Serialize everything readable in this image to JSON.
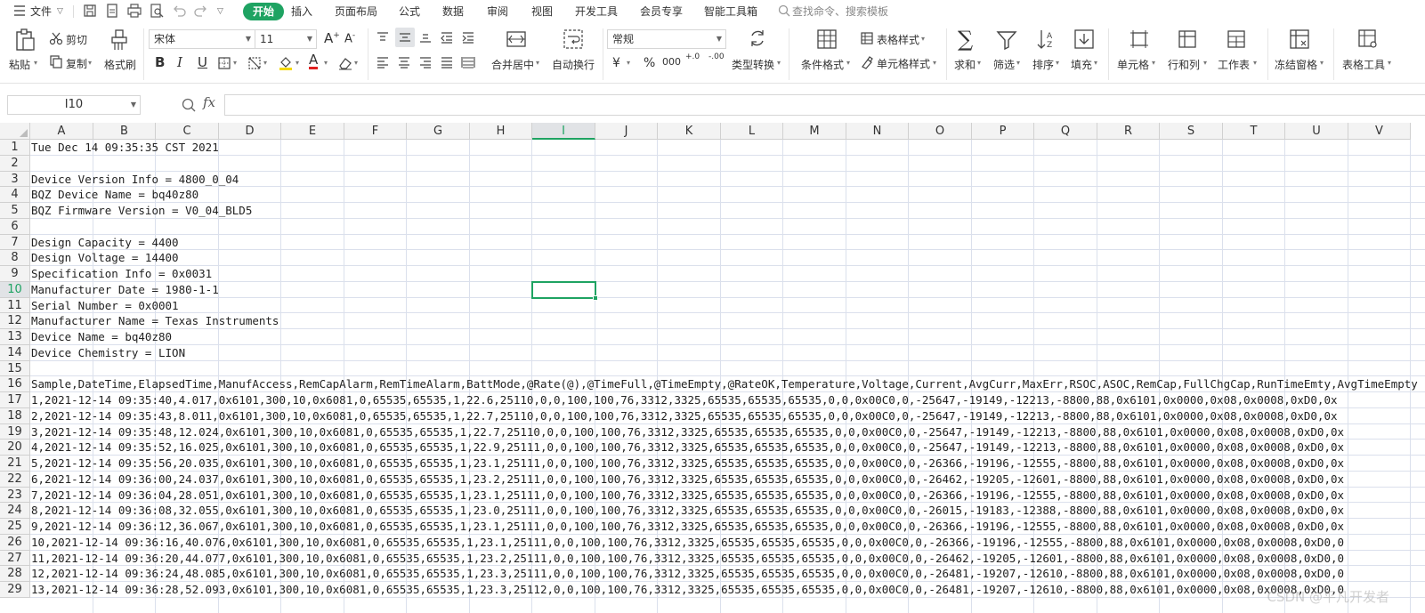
{
  "menu": {
    "file": "文件",
    "tabs": [
      "开始",
      "插入",
      "页面布局",
      "公式",
      "数据",
      "审阅",
      "视图",
      "开发工具",
      "会员专享",
      "智能工具箱"
    ],
    "search_placeholder": "查找命令、搜索模板"
  },
  "ribbon": {
    "paste": "粘贴",
    "cut": "剪切",
    "copy": "复制",
    "format_painter": "格式刷",
    "font_name": "宋体",
    "font_size": "11",
    "merge_center": "合并居中",
    "wrap_text": "自动换行",
    "number_format": "常规",
    "type_convert": "类型转换",
    "conditional_format": "条件格式",
    "table_style": "表格样式",
    "cell_style": "单元格样式",
    "sum": "求和",
    "filter": "筛选",
    "sort": "排序",
    "fill": "填充",
    "cell": "单元格",
    "row_col": "行和列",
    "worksheet": "工作表",
    "freeze": "冻结窗格",
    "table_tools": "表格工具",
    "bold": "B",
    "italic": "I",
    "underline": "U",
    "font_color_letter": "A",
    "currency": "¥",
    "percent": "%",
    "thousands": "000",
    "dec_inc": "+.0",
    "dec_dec": "-.00"
  },
  "formula_bar": {
    "name_box": "I10",
    "fx": "fx",
    "formula": ""
  },
  "grid": {
    "columns": [
      "A",
      "B",
      "C",
      "D",
      "E",
      "F",
      "G",
      "H",
      "I",
      "J",
      "K",
      "L",
      "M",
      "N",
      "O",
      "P",
      "Q",
      "R",
      "S",
      "T",
      "U",
      "V"
    ],
    "selected_column": "I",
    "selected_row": "10",
    "rows": [
      {
        "num": "1",
        "text": "Tue Dec 14 09:35:35 CST 2021"
      },
      {
        "num": "2",
        "text": ""
      },
      {
        "num": "3",
        "text": "Device Version Info = 4800_0_04"
      },
      {
        "num": "4",
        "text": "BQZ Device Name = bq40z80"
      },
      {
        "num": "5",
        "text": "BQZ Firmware Version = V0_04_BLD5"
      },
      {
        "num": "6",
        "text": ""
      },
      {
        "num": "7",
        "text": "Design Capacity = 4400"
      },
      {
        "num": "8",
        "text": "Design Voltage = 14400"
      },
      {
        "num": "9",
        "text": "Specification Info = 0x0031"
      },
      {
        "num": "10",
        "text": "Manufacturer Date = 1980-1-1"
      },
      {
        "num": "11",
        "text": "Serial Number = 0x0001"
      },
      {
        "num": "12",
        "text": "Manufacturer Name = Texas Instruments"
      },
      {
        "num": "13",
        "text": "Device Name = bq40z80"
      },
      {
        "num": "14",
        "text": "Device Chemistry = LION"
      },
      {
        "num": "15",
        "text": ""
      },
      {
        "num": "16",
        "text": "Sample,DateTime,ElapsedTime,ManufAccess,RemCapAlarm,RemTimeAlarm,BattMode,@Rate(@),@TimeFull,@TimeEmpty,@RateOK,Temperature,Voltage,Current,AvgCurr,MaxErr,RSOC,ASOC,RemCap,FullChgCap,RunTimeEmty,AvgTimeEmpty"
      },
      {
        "num": "17",
        "text": "1,2021-12-14 09:35:40,4.017,0x6101,300,10,0x6081,0,65535,65535,1,22.6,25110,0,0,100,100,76,3312,3325,65535,65535,65535,0,0,0x00C0,0,-25647,-19149,-12213,-8800,88,0x6101,0x0000,0x08,0x0008,0xD0,0x"
      },
      {
        "num": "18",
        "text": "2,2021-12-14 09:35:43,8.011,0x6101,300,10,0x6081,0,65535,65535,1,22.7,25110,0,0,100,100,76,3312,3325,65535,65535,65535,0,0,0x00C0,0,-25647,-19149,-12213,-8800,88,0x6101,0x0000,0x08,0x0008,0xD0,0x"
      },
      {
        "num": "19",
        "text": "3,2021-12-14 09:35:48,12.024,0x6101,300,10,0x6081,0,65535,65535,1,22.7,25110,0,0,100,100,76,3312,3325,65535,65535,65535,0,0,0x00C0,0,-25647,-19149,-12213,-8800,88,0x6101,0x0000,0x08,0x0008,0xD0,0x"
      },
      {
        "num": "20",
        "text": "4,2021-12-14 09:35:52,16.025,0x6101,300,10,0x6081,0,65535,65535,1,22.9,25111,0,0,100,100,76,3312,3325,65535,65535,65535,0,0,0x00C0,0,-25647,-19149,-12213,-8800,88,0x6101,0x0000,0x08,0x0008,0xD0,0x"
      },
      {
        "num": "21",
        "text": "5,2021-12-14 09:35:56,20.035,0x6101,300,10,0x6081,0,65535,65535,1,23.1,25111,0,0,100,100,76,3312,3325,65535,65535,65535,0,0,0x00C0,0,-26366,-19196,-12555,-8800,88,0x6101,0x0000,0x08,0x0008,0xD0,0x"
      },
      {
        "num": "22",
        "text": "6,2021-12-14 09:36:00,24.037,0x6101,300,10,0x6081,0,65535,65535,1,23.2,25111,0,0,100,100,76,3312,3325,65535,65535,65535,0,0,0x00C0,0,-26462,-19205,-12601,-8800,88,0x6101,0x0000,0x08,0x0008,0xD0,0x"
      },
      {
        "num": "23",
        "text": "7,2021-12-14 09:36:04,28.051,0x6101,300,10,0x6081,0,65535,65535,1,23.1,25111,0,0,100,100,76,3312,3325,65535,65535,65535,0,0,0x00C0,0,-26366,-19196,-12555,-8800,88,0x6101,0x0000,0x08,0x0008,0xD0,0x"
      },
      {
        "num": "24",
        "text": "8,2021-12-14 09:36:08,32.055,0x6101,300,10,0x6081,0,65535,65535,1,23.0,25111,0,0,100,100,76,3312,3325,65535,65535,65535,0,0,0x00C0,0,-26015,-19183,-12388,-8800,88,0x6101,0x0000,0x08,0x0008,0xD0,0x"
      },
      {
        "num": "25",
        "text": "9,2021-12-14 09:36:12,36.067,0x6101,300,10,0x6081,0,65535,65535,1,23.1,25111,0,0,100,100,76,3312,3325,65535,65535,65535,0,0,0x00C0,0,-26366,-19196,-12555,-8800,88,0x6101,0x0000,0x08,0x0008,0xD0,0x"
      },
      {
        "num": "26",
        "text": "10,2021-12-14 09:36:16,40.076,0x6101,300,10,0x6081,0,65535,65535,1,23.1,25111,0,0,100,100,76,3312,3325,65535,65535,65535,0,0,0x00C0,0,-26366,-19196,-12555,-8800,88,0x6101,0x0000,0x08,0x0008,0xD0,0"
      },
      {
        "num": "27",
        "text": "11,2021-12-14 09:36:20,44.077,0x6101,300,10,0x6081,0,65535,65535,1,23.2,25111,0,0,100,100,76,3312,3325,65535,65535,65535,0,0,0x00C0,0,-26462,-19205,-12601,-8800,88,0x6101,0x0000,0x08,0x0008,0xD0,0"
      },
      {
        "num": "28",
        "text": "12,2021-12-14 09:36:24,48.085,0x6101,300,10,0x6081,0,65535,65535,1,23.3,25111,0,0,100,100,76,3312,3325,65535,65535,65535,0,0,0x00C0,0,-26481,-19207,-12610,-8800,88,0x6101,0x0000,0x08,0x0008,0xD0,0"
      },
      {
        "num": "29",
        "text": "13,2021-12-14 09:36:28,52.093,0x6101,300,10,0x6081,0,65535,65535,1,23.3,25112,0,0,100,100,76,3312,3325,65535,65535,65535,0,0,0x00C0,0,-26481,-19207,-12610,-8800,88,0x6101,0x0000,0x08,0x0008,0xD0,0"
      }
    ]
  },
  "watermark": "CSDN @平凡开发者",
  "colors": {
    "accent": "#1ea362",
    "grid_line": "#dbe0ec",
    "header_bg": "#f3f3f3"
  }
}
